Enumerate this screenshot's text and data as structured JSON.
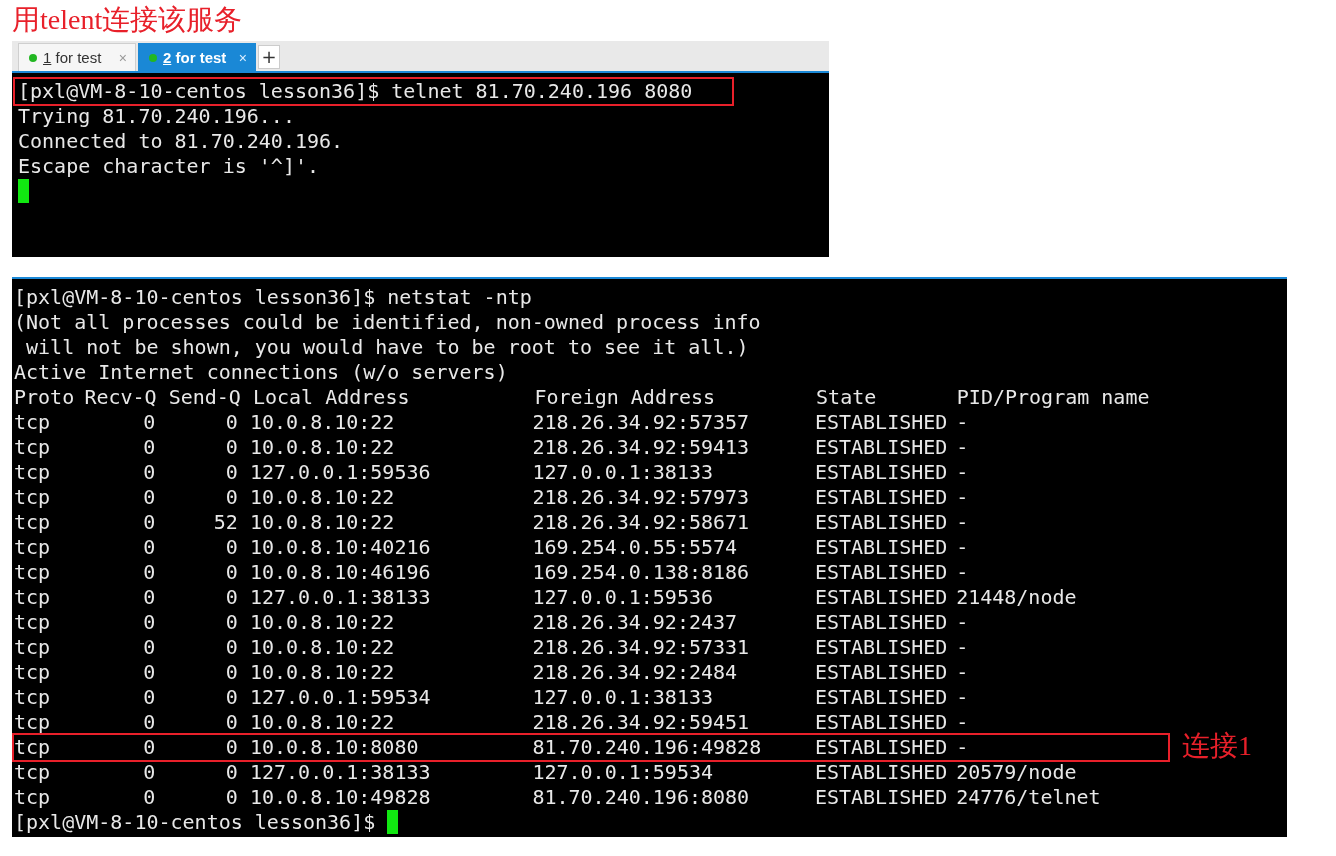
{
  "annotation_title": "用telent连接该服务",
  "tabs": [
    {
      "number": "1",
      "label": "for test",
      "selected": false,
      "close": "×"
    },
    {
      "number": "2",
      "label": "for test",
      "selected": true,
      "close": "×"
    }
  ],
  "new_tab": "+",
  "terminal_1": {
    "lines": [
      {
        "text": "[pxl@VM-8-10-centos lesson36]$ telnet 81.70.240.196 8080",
        "highlighted": true
      },
      {
        "text": "Trying 81.70.240.196...",
        "highlighted": false
      },
      {
        "text": "Connected to 81.70.240.196.",
        "highlighted": false
      },
      {
        "text": "Escape character is '^]'.",
        "highlighted": false
      }
    ],
    "cursor": true
  },
  "terminal_2": {
    "intro_lines": [
      "[pxl@VM-8-10-centos lesson36]$ netstat -ntp",
      "(Not all processes could be identified, non-owned process info",
      " will not be shown, you would have to be root to see it all.)",
      "Active Internet connections (w/o servers)"
    ],
    "columns": [
      "Proto",
      "Recv-Q",
      "Send-Q",
      "Local Address",
      "Foreign Address",
      "State",
      "PID/Program name"
    ],
    "rows": [
      {
        "cells": [
          "tcp",
          "0",
          "0",
          "10.0.8.10:22",
          "218.26.34.92:57357",
          "ESTABLISHED",
          "-"
        ],
        "highlighted": false
      },
      {
        "cells": [
          "tcp",
          "0",
          "0",
          "10.0.8.10:22",
          "218.26.34.92:59413",
          "ESTABLISHED",
          "-"
        ],
        "highlighted": false
      },
      {
        "cells": [
          "tcp",
          "0",
          "0",
          "127.0.0.1:59536",
          "127.0.0.1:38133",
          "ESTABLISHED",
          "-"
        ],
        "highlighted": false
      },
      {
        "cells": [
          "tcp",
          "0",
          "0",
          "10.0.8.10:22",
          "218.26.34.92:57973",
          "ESTABLISHED",
          "-"
        ],
        "highlighted": false
      },
      {
        "cells": [
          "tcp",
          "0",
          "52",
          "10.0.8.10:22",
          "218.26.34.92:58671",
          "ESTABLISHED",
          "-"
        ],
        "highlighted": false
      },
      {
        "cells": [
          "tcp",
          "0",
          "0",
          "10.0.8.10:40216",
          "169.254.0.55:5574",
          "ESTABLISHED",
          "-"
        ],
        "highlighted": false
      },
      {
        "cells": [
          "tcp",
          "0",
          "0",
          "10.0.8.10:46196",
          "169.254.0.138:8186",
          "ESTABLISHED",
          "-"
        ],
        "highlighted": false
      },
      {
        "cells": [
          "tcp",
          "0",
          "0",
          "127.0.0.1:38133",
          "127.0.0.1:59536",
          "ESTABLISHED",
          "21448/node"
        ],
        "highlighted": false
      },
      {
        "cells": [
          "tcp",
          "0",
          "0",
          "10.0.8.10:22",
          "218.26.34.92:2437",
          "ESTABLISHED",
          "-"
        ],
        "highlighted": false
      },
      {
        "cells": [
          "tcp",
          "0",
          "0",
          "10.0.8.10:22",
          "218.26.34.92:57331",
          "ESTABLISHED",
          "-"
        ],
        "highlighted": false
      },
      {
        "cells": [
          "tcp",
          "0",
          "0",
          "10.0.8.10:22",
          "218.26.34.92:2484",
          "ESTABLISHED",
          "-"
        ],
        "highlighted": false
      },
      {
        "cells": [
          "tcp",
          "0",
          "0",
          "127.0.0.1:59534",
          "127.0.0.1:38133",
          "ESTABLISHED",
          "-"
        ],
        "highlighted": false
      },
      {
        "cells": [
          "tcp",
          "0",
          "0",
          "10.0.8.10:22",
          "218.26.34.92:59451",
          "ESTABLISHED",
          "-"
        ],
        "highlighted": false
      },
      {
        "cells": [
          "tcp",
          "0",
          "0",
          "10.0.8.10:8080",
          "81.70.240.196:49828",
          "ESTABLISHED",
          "-"
        ],
        "highlighted": true,
        "callout": "连接1"
      },
      {
        "cells": [
          "tcp",
          "0",
          "0",
          "127.0.0.1:38133",
          "127.0.0.1:59534",
          "ESTABLISHED",
          "20579/node"
        ],
        "highlighted": false
      },
      {
        "cells": [
          "tcp",
          "0",
          "0",
          "10.0.8.10:49828",
          "81.70.240.196:8080",
          "ESTABLISHED",
          "24776/telnet"
        ],
        "highlighted": false
      }
    ],
    "final_prompt": "[pxl@VM-8-10-centos lesson36]$",
    "cursor": true
  }
}
